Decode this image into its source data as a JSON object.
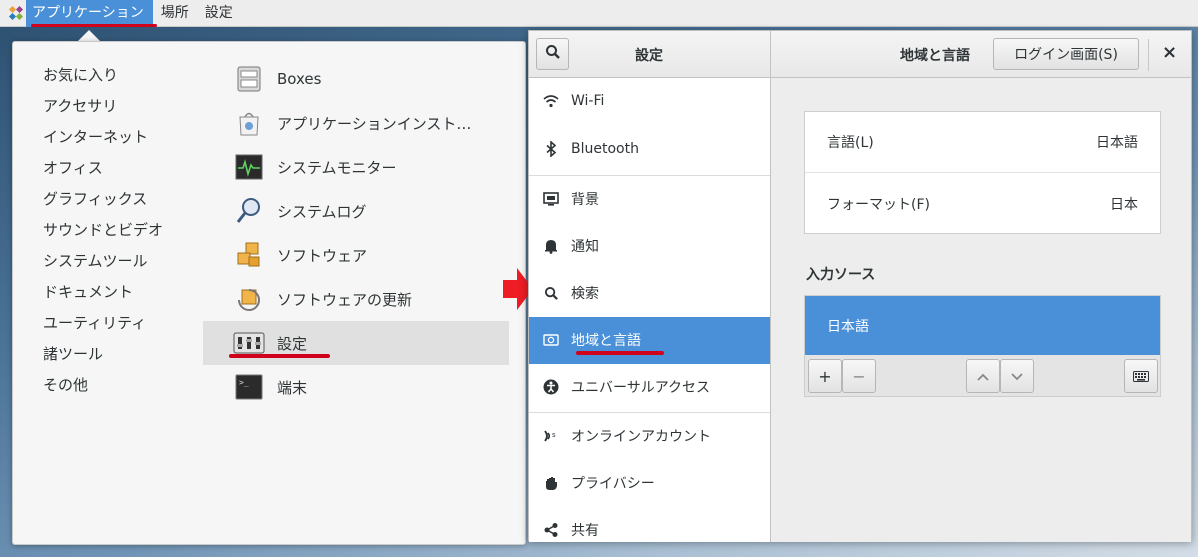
{
  "topbar": {
    "menus": [
      "アプリケーション",
      "場所",
      "設定"
    ]
  },
  "appmenu": {
    "categories": [
      "お気に入り",
      "アクセサリ",
      "インターネット",
      "オフィス",
      "グラフィックス",
      "サウンドとビデオ",
      "システムツール",
      "ドキュメント",
      "ユーティリティ",
      "諸ツール",
      "その他"
    ],
    "apps": [
      {
        "label": "Boxes",
        "icon": "boxes-icon"
      },
      {
        "label": "アプリケーションインスト…",
        "icon": "app-installer-icon"
      },
      {
        "label": "システムモニター",
        "icon": "system-monitor-icon"
      },
      {
        "label": "システムログ",
        "icon": "system-log-icon"
      },
      {
        "label": "ソフトウェア",
        "icon": "software-icon"
      },
      {
        "label": "ソフトウェアの更新",
        "icon": "software-update-icon"
      },
      {
        "label": "設定",
        "icon": "settings-app-icon"
      },
      {
        "label": "端末",
        "icon": "terminal-icon"
      }
    ],
    "selected_app": "設定"
  },
  "settings": {
    "sidebar_title": "設定",
    "page_title": "地域と言語",
    "login_button": "ログイン画面(S)",
    "close_glyph": "×",
    "sidebar_items": [
      {
        "label": "Wi-Fi",
        "icon": "wifi-icon"
      },
      {
        "label": "Bluetooth",
        "icon": "bluetooth-icon"
      },
      {
        "label": "背景",
        "icon": "background-icon"
      },
      {
        "label": "通知",
        "icon": "bell-icon"
      },
      {
        "label": "検索",
        "icon": "search-icon"
      },
      {
        "label": "地域と言語",
        "icon": "region-icon"
      },
      {
        "label": "ユニバーサルアクセス",
        "icon": "accessibility-icon"
      },
      {
        "label": "オンラインアカウント",
        "icon": "online-accounts-icon"
      },
      {
        "label": "プライバシー",
        "icon": "hand-icon"
      },
      {
        "label": "共有",
        "icon": "share-icon"
      }
    ],
    "selected_item": "地域と言語",
    "language_label": "言語(L)",
    "language_value": "日本語",
    "format_label": "フォーマット(F)",
    "format_value": "日本",
    "input_sources_heading": "入力ソース",
    "input_sources": [
      "日本語"
    ],
    "add_glyph": "+",
    "remove_glyph": "−"
  },
  "colors": {
    "accent": "#4a90d9",
    "annotation_red": "#d0021b"
  }
}
